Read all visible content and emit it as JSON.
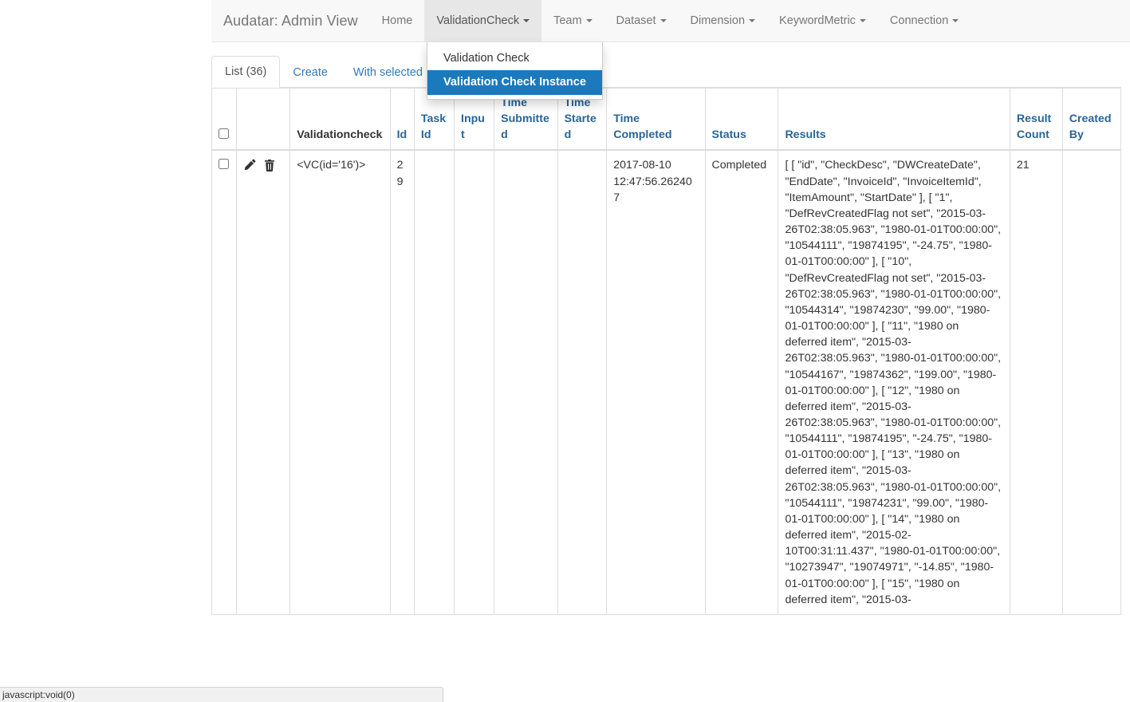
{
  "navbar": {
    "brand": "Audatar: Admin View",
    "items": [
      {
        "label": "Home",
        "caret": false,
        "open": false
      },
      {
        "label": "ValidationCheck",
        "caret": true,
        "open": true
      },
      {
        "label": "Team",
        "caret": true,
        "open": false
      },
      {
        "label": "Dataset",
        "caret": true,
        "open": false
      },
      {
        "label": "Dimension",
        "caret": true,
        "open": false
      },
      {
        "label": "KeywordMetric",
        "caret": true,
        "open": false
      },
      {
        "label": "Connection",
        "caret": true,
        "open": false
      }
    ]
  },
  "dropdown": {
    "items": [
      {
        "label": "Validation Check",
        "active": false
      },
      {
        "label": "Validation Check Instance",
        "active": true
      }
    ],
    "highlight_color": "#1b79be"
  },
  "tabs": [
    {
      "label": "List (36)",
      "active": true,
      "caret": false
    },
    {
      "label": "Create",
      "active": false,
      "caret": false
    },
    {
      "label": "With selected",
      "active": false,
      "caret": true
    }
  ],
  "table": {
    "headers": [
      {
        "label": "",
        "kind": "checkbox"
      },
      {
        "label": "",
        "kind": "ops"
      },
      {
        "label": "Validationcheck",
        "kind": "plain"
      },
      {
        "label": "Id",
        "kind": "link"
      },
      {
        "label": "Task Id",
        "kind": "link"
      },
      {
        "label": "Input",
        "kind": "link"
      },
      {
        "label": "Time Submitted",
        "kind": "link"
      },
      {
        "label": "Time Started",
        "kind": "link"
      },
      {
        "label": "Time Completed",
        "kind": "link"
      },
      {
        "label": "Status",
        "kind": "link"
      },
      {
        "label": "Results",
        "kind": "link"
      },
      {
        "label": "Result Count",
        "kind": "link"
      },
      {
        "label": "Created By",
        "kind": "link"
      }
    ],
    "rows": [
      {
        "edit_icon": "pencil-icon",
        "delete_icon": "trash-icon",
        "validationcheck": "<VC(id='16')>",
        "id": "29",
        "task_id": "",
        "input": "",
        "time_submitted": "",
        "time_started": "",
        "time_completed": "2017-08-10 12:47:56.262407",
        "status": "Completed",
        "results": "[ [ \"id\", \"CheckDesc\", \"DWCreateDate\", \"EndDate\", \"InvoiceId\", \"InvoiceItemId\", \"ItemAmount\", \"StartDate\" ], [ \"1\", \"DefRevCreatedFlag not set\", \"2015-03-26T02:38:05.963\", \"1980-01-01T00:00:00\", \"10544111\", \"19874195\", \"-24.75\", \"1980-01-01T00:00:00\" ], [ \"10\", \"DefRevCreatedFlag not set\", \"2015-03-26T02:38:05.963\", \"1980-01-01T00:00:00\", \"10544314\", \"19874230\", \"99.00\", \"1980-01-01T00:00:00\" ], [ \"11\", \"1980 on deferred item\", \"2015-03-26T02:38:05.963\", \"1980-01-01T00:00:00\", \"10544167\", \"19874362\", \"199.00\", \"1980-01-01T00:00:00\" ], [ \"12\", \"1980 on deferred item\", \"2015-03-26T02:38:05.963\", \"1980-01-01T00:00:00\", \"10544111\", \"19874195\", \"-24.75\", \"1980-01-01T00:00:00\" ], [ \"13\", \"1980 on deferred item\", \"2015-03-26T02:38:05.963\", \"1980-01-01T00:00:00\", \"10544111\", \"19874231\", \"99.00\", \"1980-01-01T00:00:00\" ], [ \"14\", \"1980 on deferred item\", \"2015-02-10T00:31:11.437\", \"1980-01-01T00:00:00\", \"10273947\", \"19074971\", \"-14.85\", \"1980-01-01T00:00:00\" ], [ \"15\", \"1980 on deferred item\", \"2015-03-",
        "result_count": "21",
        "created_by": ""
      }
    ]
  },
  "statusbar": {
    "text": "javascript:void(0)"
  }
}
